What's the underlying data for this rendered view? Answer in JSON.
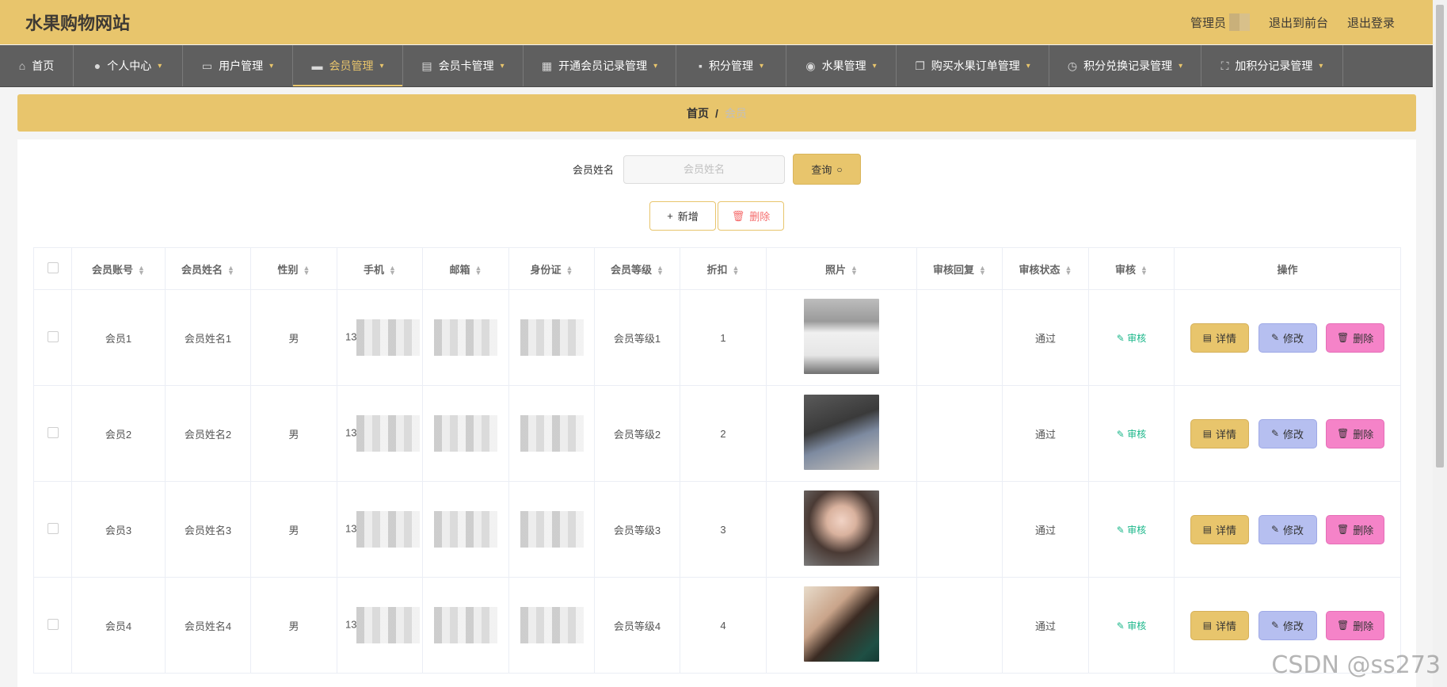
{
  "header": {
    "title": "水果购物网站",
    "admin_label": "管理员",
    "to_front": "退出到前台",
    "logout": "退出登录"
  },
  "nav": [
    {
      "label": "首页",
      "icon": "home-icon"
    },
    {
      "label": "个人中心",
      "icon": "user-icon"
    },
    {
      "label": "用户管理",
      "icon": "ticket-icon"
    },
    {
      "label": "会员管理",
      "icon": "monitor-icon"
    },
    {
      "label": "会员卡管理",
      "icon": "clipboard-icon"
    },
    {
      "label": "开通会员记录管理",
      "icon": "grid-icon"
    },
    {
      "label": "积分管理",
      "icon": "chat-icon"
    },
    {
      "label": "水果管理",
      "icon": "location-icon"
    },
    {
      "label": "购买水果订单管理",
      "icon": "copy-icon"
    },
    {
      "label": "积分兑换记录管理",
      "icon": "clock-icon"
    },
    {
      "label": "加积分记录管理",
      "icon": "fullscreen-icon"
    }
  ],
  "breadcrumb": {
    "home": "首页",
    "sep": "/",
    "current": "会员"
  },
  "search": {
    "label": "会员姓名",
    "placeholder": "会员姓名",
    "value": "",
    "button": "查询"
  },
  "actions": {
    "add": "新增",
    "delete": "删除"
  },
  "table": {
    "headers": [
      "会员账号",
      "会员姓名",
      "性别",
      "手机",
      "邮箱",
      "身份证",
      "会员等级",
      "折扣",
      "照片",
      "审核回复",
      "审核状态",
      "审核",
      "操作"
    ],
    "rows": [
      {
        "account": "会员1",
        "name": "会员姓名1",
        "gender": "男",
        "phone": "13",
        "level": "会员等级1",
        "discount": "1",
        "reply": "",
        "status": "通过"
      },
      {
        "account": "会员2",
        "name": "会员姓名2",
        "gender": "男",
        "phone": "13",
        "level": "会员等级2",
        "discount": "2",
        "reply": "",
        "status": "通过"
      },
      {
        "account": "会员3",
        "name": "会员姓名3",
        "gender": "男",
        "phone": "13",
        "level": "会员等级3",
        "discount": "3",
        "reply": "",
        "status": "通过"
      },
      {
        "account": "会员4",
        "name": "会员姓名4",
        "gender": "男",
        "phone": "13",
        "level": "会员等级4",
        "discount": "4",
        "reply": "",
        "status": "通过"
      }
    ],
    "audit_label": "审核",
    "op": {
      "detail": "详情",
      "edit": "修改",
      "delete": "删除"
    }
  },
  "watermark": "CSDN @ss273",
  "colors": {
    "accent": "#e8c56c",
    "nav": "#5f5f5f",
    "detail": "#e8c56c",
    "edit": "#b6bff0",
    "delete": "#f583c8",
    "audit": "#1bb78a"
  }
}
